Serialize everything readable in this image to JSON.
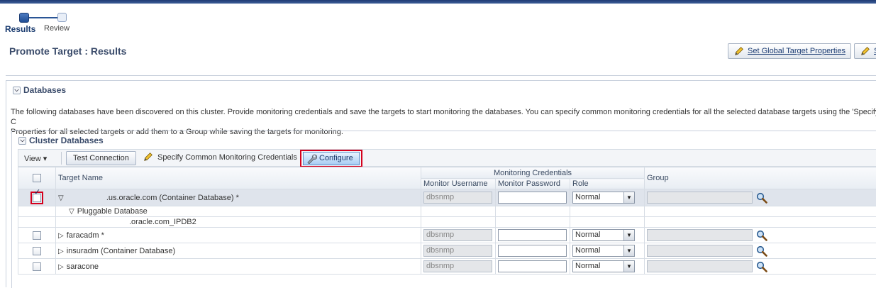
{
  "train": {
    "step1_label": "Results",
    "step2_label": "Review"
  },
  "page": {
    "title": "Promote Target : Results"
  },
  "global_buttons": {
    "set_global_props": "Set Global Target Properties",
    "second_partial": "S"
  },
  "databases_section": {
    "title": "Databases",
    "description": "The following databases have been discovered on this cluster. Provide monitoring credentials and save the targets to start monitoring the databases. You can specify common monitoring credentials for all the selected database targets using the 'Specify C",
    "description_line2": "Properties for all selected targets or add them to a Group while saving the targets for monitoring."
  },
  "cluster_section": {
    "title": "Cluster Databases"
  },
  "toolbar": {
    "view_label": "View",
    "test_connection": "Test Connection",
    "specify_credentials": "Specify Common Monitoring Credentials",
    "configure": "Configure"
  },
  "table": {
    "headers": {
      "target_name": "Target Name",
      "monitoring_credentials": "Monitoring Credentials",
      "monitor_username": "Monitor Username",
      "monitor_password": "Monitor Password",
      "role": "Role",
      "group": "Group"
    },
    "rows": [
      {
        "target": ".us.oracle.com (Container Database) *",
        "username": "dbsnmp",
        "role": "Normal",
        "checked": true
      },
      {
        "target": "Pluggable Database"
      },
      {
        "target": ".oracle.com_IPDB2"
      },
      {
        "target": "faracadm *",
        "username": "dbsnmp",
        "role": "Normal",
        "checked": false
      },
      {
        "target": "insuradm (Container Database)",
        "username": "dbsnmp",
        "role": "Normal",
        "checked": false
      },
      {
        "target": "saracone",
        "username": "dbsnmp",
        "role": "Normal",
        "checked": false
      }
    ]
  },
  "icons": {
    "pencil": "pencil-icon",
    "wrench": "wrench-icon",
    "search": "search-icon"
  },
  "colors": {
    "highlight_outline": "#d4001d",
    "accent": "#1c3c73"
  }
}
